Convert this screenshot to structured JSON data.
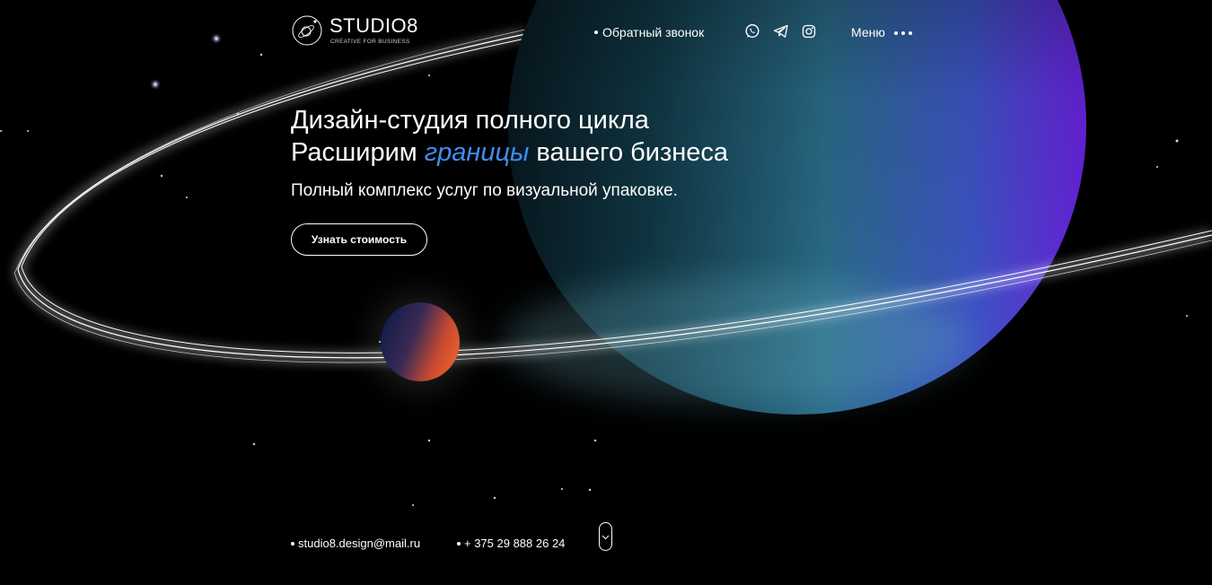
{
  "header": {
    "logo": {
      "name": "STUDIO8",
      "tagline": "CREATIVE FOR BUSINESS"
    },
    "callback_label": "Обратный звонок",
    "social": [
      "whatsapp-icon",
      "telegram-icon",
      "instagram-icon"
    ],
    "menu_label": "Меню"
  },
  "hero": {
    "title_line1": "Дизайн-студия полного цикла",
    "title_line2_before": "Расширим ",
    "title_line2_accent": "границы",
    "title_line2_after": " вашего бизнеса",
    "subtitle": "Полный комплекс услуг по визуальной упаковке.",
    "cta_label": "Узнать стоимость"
  },
  "footer": {
    "email": "studio8.design@mail.ru",
    "phone": "+ 375 29 888 26 24",
    "scroll_icon": "chevron-down-icon"
  },
  "colors": {
    "background": "#000000",
    "accent": "#3f8ef0",
    "planet_purple": "#6a28e0",
    "planet_teal": "#2e8a9a",
    "small_planet_orange": "#e05a30",
    "small_planet_navy": "#1c2350"
  }
}
